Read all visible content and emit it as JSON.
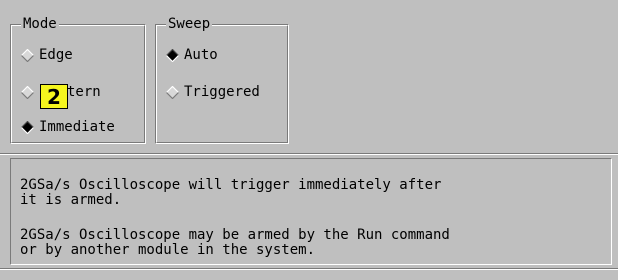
{
  "mode": {
    "legend": "Mode",
    "options": [
      {
        "label": "Edge",
        "selected": false
      },
      {
        "label": "tern",
        "selected": false
      },
      {
        "label": "Immediate",
        "selected": true
      }
    ]
  },
  "sweep": {
    "legend": "Sweep",
    "options": [
      {
        "label": "Auto",
        "selected": true
      },
      {
        "label": "Triggered",
        "selected": false
      }
    ]
  },
  "callout": {
    "number": "2"
  },
  "messages": {
    "p1_line1": "2GSa/s Oscilloscope will trigger immediately after",
    "p1_line2": "it is armed.",
    "p2_line1": "2GSa/s Oscilloscope may be armed by the Run command",
    "p2_line2": "or by another module in the system."
  }
}
